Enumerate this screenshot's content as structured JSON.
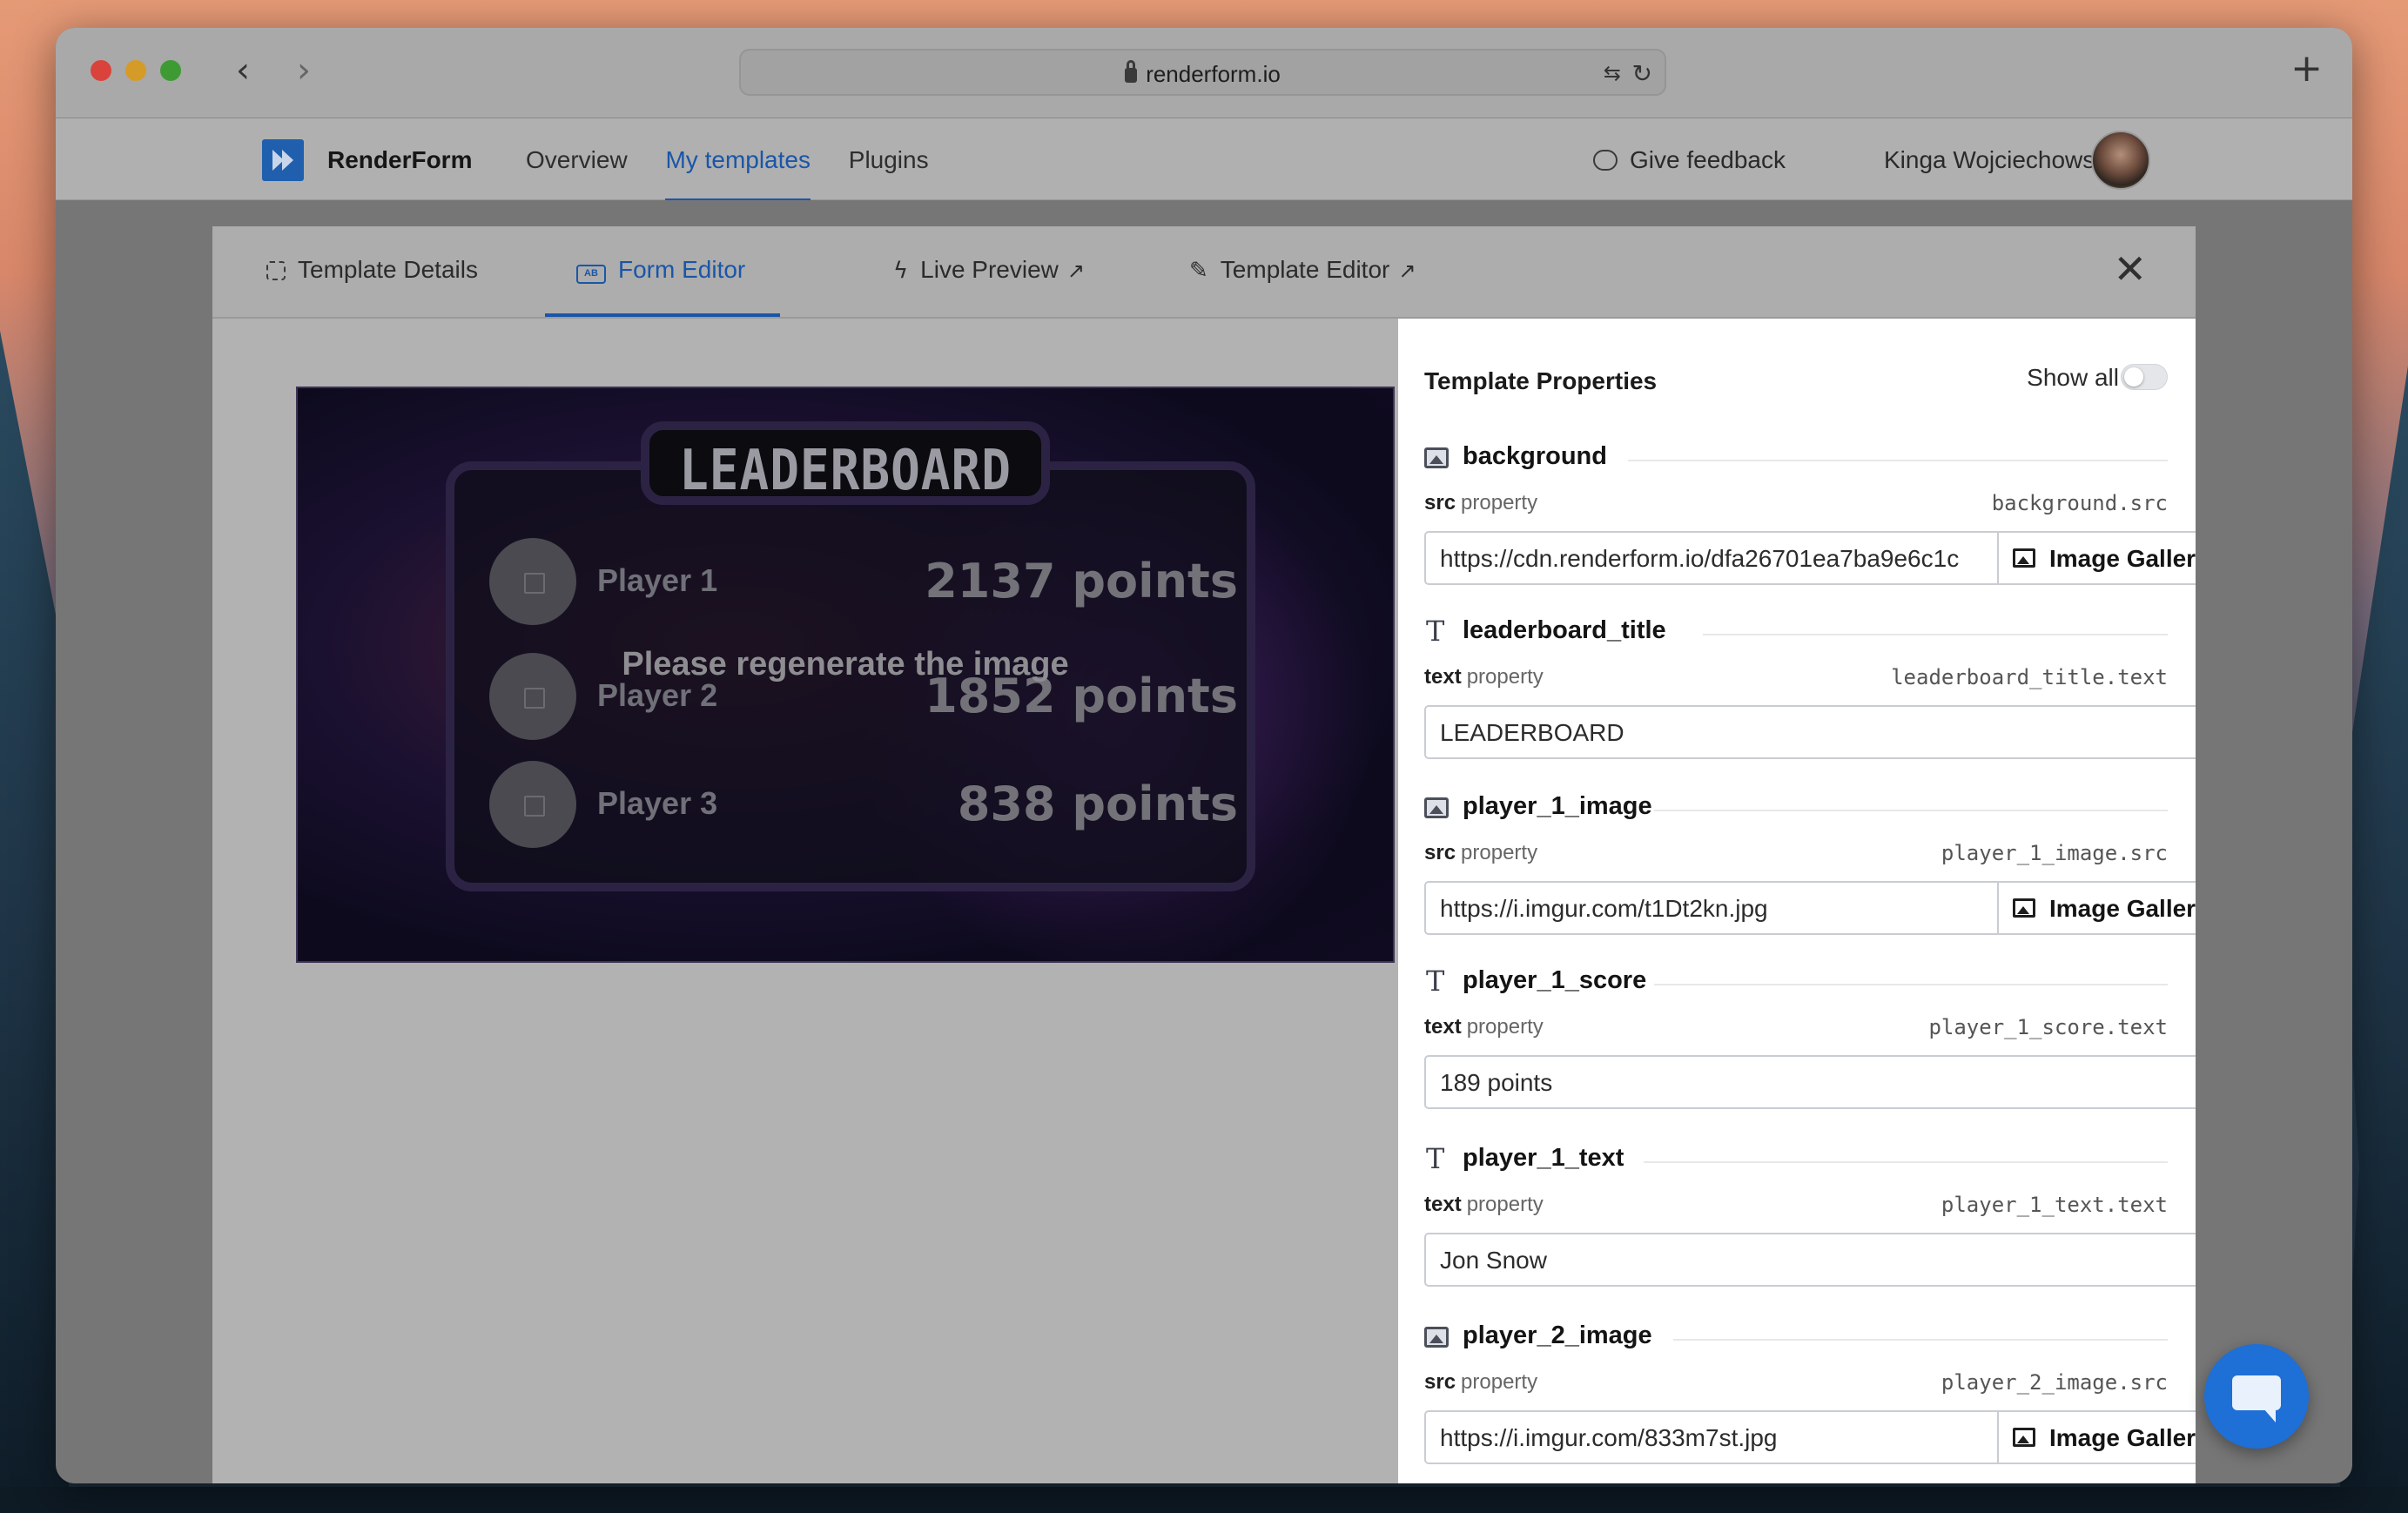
{
  "browser": {
    "url": "renderform.io"
  },
  "app": {
    "brand": "RenderForm",
    "nav": [
      "Overview",
      "My templates",
      "Plugins"
    ],
    "active_nav": "My templates",
    "feedback_label": "Give feedback",
    "user_name": "Kinga Wojciechowska"
  },
  "modal": {
    "tabs": {
      "details": "Template Details",
      "form": "Form Editor",
      "live": "Live Preview",
      "editor": "Template Editor"
    },
    "active_tab": "Form Editor"
  },
  "preview": {
    "title": "LEADERBOARD",
    "players": [
      {
        "name": "Player 1",
        "score": "2137 points"
      },
      {
        "name": "Player 2",
        "score": "1852 points"
      },
      {
        "name": "Player 3",
        "score": "838 points"
      }
    ],
    "overlay_message": "Please regenerate the image"
  },
  "properties": {
    "title": "Template Properties",
    "show_all_label": "Show all",
    "show_all_on": false,
    "property_word": "property",
    "gallery_label": "Image Gallery",
    "items": [
      {
        "name": "background",
        "kind": "image",
        "key": "src",
        "path": "background.src",
        "value": "https://cdn.renderform.io/dfa26701ea7ba9e6c1c"
      },
      {
        "name": "leaderboard_title",
        "kind": "text",
        "key": "text",
        "path": "leaderboard_title.text",
        "value": "LEADERBOARD"
      },
      {
        "name": "player_1_image",
        "kind": "image",
        "key": "src",
        "path": "player_1_image.src",
        "value": "https://i.imgur.com/t1Dt2kn.jpg"
      },
      {
        "name": "player_1_score",
        "kind": "text",
        "key": "text",
        "path": "player_1_score.text",
        "value": "189 points"
      },
      {
        "name": "player_1_text",
        "kind": "text",
        "key": "text",
        "path": "player_1_text.text",
        "value": "Jon Snow"
      },
      {
        "name": "player_2_image",
        "kind": "image",
        "key": "src",
        "path": "player_2_image.src",
        "value": "https://i.imgur.com/833m7st.jpg"
      }
    ]
  },
  "colors": {
    "accent": "#1a56a8",
    "chat_fab": "#1e6fd6"
  }
}
